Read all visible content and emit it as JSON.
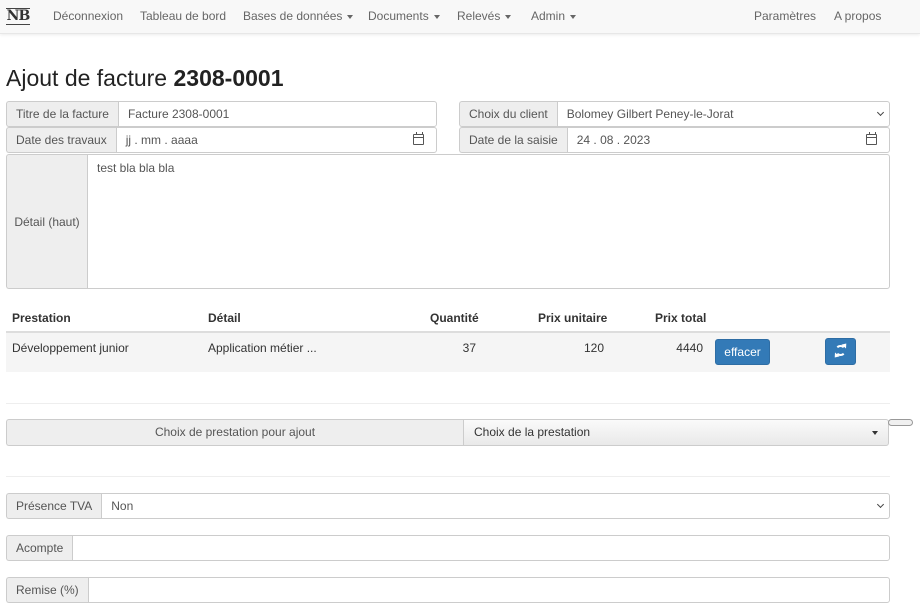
{
  "nav": {
    "brand": "NB",
    "deconnexion": "Déconnexion",
    "tableau": "Tableau de bord",
    "bases": "Bases de données",
    "documents": "Documents",
    "releves": "Relevés",
    "admin": "Admin",
    "parametres": "Paramètres",
    "apropos": "A propos"
  },
  "title": {
    "prefix": "Ajout de facture",
    "number": "2308-0001"
  },
  "form": {
    "titre_label": "Titre de la facture",
    "titre_value": "Facture 2308-0001",
    "client_label": "Choix du client",
    "client_value": "Bolomey Gilbert Peney-le-Jorat",
    "date_travaux_label": "Date des travaux",
    "date_travaux_placeholder": "jj . mm . aaaa",
    "date_saisie_label": "Date de la saisie",
    "date_saisie_value": "24 . 08 . 2023",
    "detail_label": "Détail (haut)",
    "detail_value": "test bla bla bla"
  },
  "table": {
    "headers": [
      "Prestation",
      "Détail",
      "Quantité",
      "Prix unitaire",
      "Prix total"
    ],
    "rows": [
      {
        "prestation": "Développement junior",
        "detail": "Application métier ...",
        "quantite": "37",
        "prix_unitaire": "120",
        "prix_total": "4440"
      }
    ],
    "delete_label": "effacer"
  },
  "ajout": {
    "label": "Choix de prestation pour ajout",
    "select_value": "Choix de la prestation"
  },
  "tva": {
    "label": "Présence TVA",
    "value": "Non"
  },
  "acompte": {
    "label": "Acompte",
    "value": ""
  },
  "remise": {
    "label": "Remise (%)",
    "value": ""
  },
  "colors": {
    "primary": "#337ab7",
    "addon_bg": "#eeeeee",
    "border": "#cccccc"
  }
}
